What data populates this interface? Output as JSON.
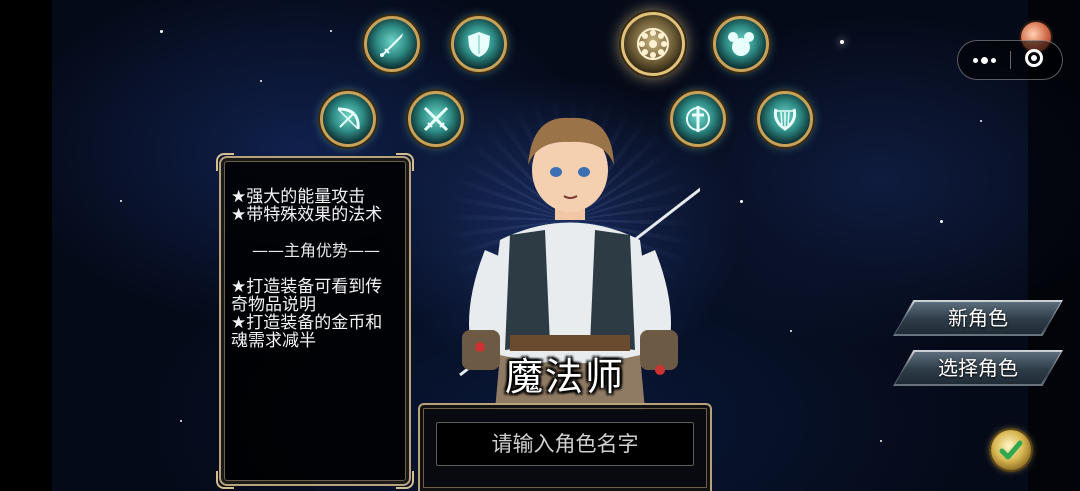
{
  "class_icons": [
    {
      "name": "sword"
    },
    {
      "name": "shield"
    },
    {
      "name": "magic-wheel",
      "selected": true
    },
    {
      "name": "bubbles"
    },
    {
      "name": "bow"
    },
    {
      "name": "crossed-swords"
    },
    {
      "name": "sword-emblem"
    },
    {
      "name": "lyre"
    }
  ],
  "info_panel": {
    "traits": [
      "★强大的能量攻击",
      "★带特殊效果的法术"
    ],
    "section_title": "——主角优势——",
    "advantages": [
      "★打造装备可看到传",
      "奇物品说明",
      "★打造装备的金币和",
      "魂需求减半"
    ]
  },
  "class_name": "魔法师",
  "name_input": {
    "placeholder": "请输入角色名字",
    "value": ""
  },
  "buttons": {
    "new_role": "新角色",
    "select_role": "选择角色"
  },
  "colors": {
    "gold_border": "#b9a27a",
    "icon_teal": "#2f8c86",
    "button_steel": "#3f4a55"
  }
}
